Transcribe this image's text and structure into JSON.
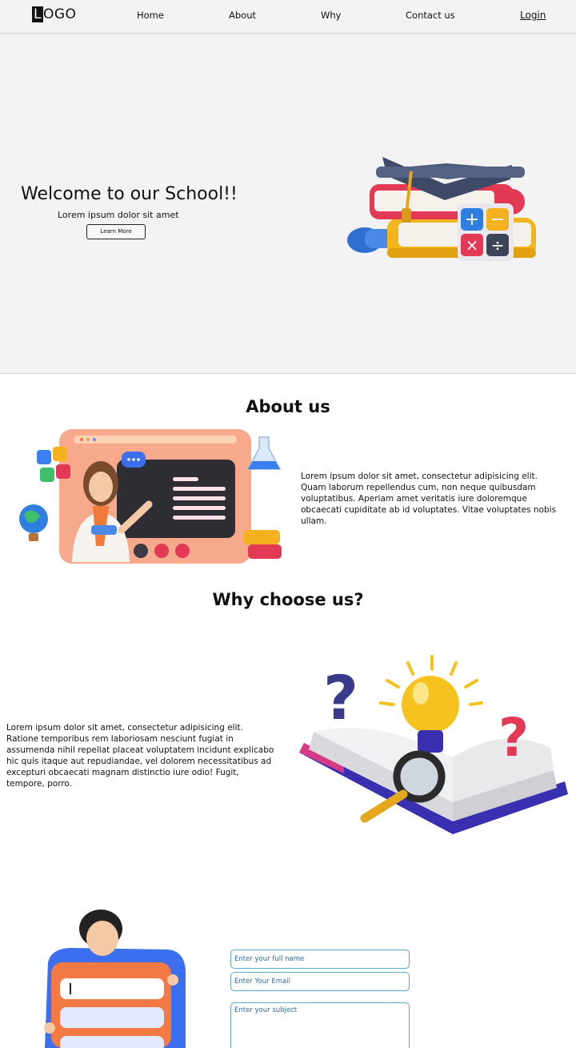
{
  "nav": {
    "logo": {
      "boxed_letter": "L",
      "rest": "OGO"
    },
    "links": [
      "Home",
      "About",
      "Why",
      "Contact us"
    ],
    "login": "Login"
  },
  "hero": {
    "title": "Welcome to our School!!",
    "subtitle": "Lorem ipsum dolor sit amet",
    "button": "Learn More",
    "illustration": "graduation-cap-books-calculator"
  },
  "about": {
    "title": "About us",
    "text": "Lorem ipsum dolor sit amet, consectetur adipisicing elit. Quam laborum repellendus cum, non neque quibusdam voluptatibus. Aperiam amet veritatis iure doloremque obcaecati cupiditate ab id voluptates. Vitae voluptates nobis ullam.",
    "illustration": "online-teacher-video-call"
  },
  "why": {
    "title": "Why choose us?",
    "text": "Lorem ipsum dolor sit amet, consectetur adipisicing elit. Ratione temporibus rem laboriosam nesciunt fugiat in assumenda nihil repellat placeat voluptatem incidunt explicabo hic quis itaque aut repudiandae, vel dolorem necessitatibus ad excepturi obcaecati magnam distinctio iure odio! Fugit, tempore, porro.",
    "illustration": "open-book-lightbulb-question-marks"
  },
  "contact": {
    "illustration": "person-holding-form",
    "name_placeholder": "Enter your full name",
    "email_placeholder": "Enter Your Email",
    "subject_placeholder": "Enter your subject"
  },
  "colors": {
    "background": "#f3f3f3",
    "field_border": "#5aa8cc",
    "field_text": "#2d6a9f"
  }
}
